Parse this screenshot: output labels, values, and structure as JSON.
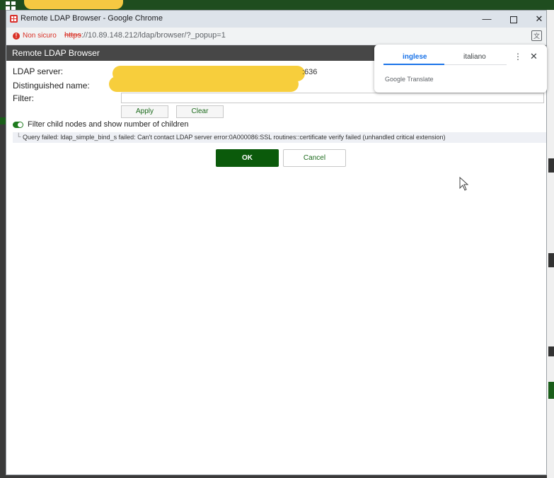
{
  "browser": {
    "window_title": "Remote LDAP Browser - Google Chrome",
    "minimize_glyph": "—",
    "close_glyph": "✕",
    "security_label": "Non sicuro",
    "url_scheme": "https",
    "url_rest": "://10.89.148.212/ldap/browser/?_popup=1"
  },
  "dialog": {
    "title": "Remote LDAP Browser",
    "ldap_server_label": "LDAP server:",
    "ldap_server_port": ":636",
    "dn_label": "Distinguished name:",
    "filter_label": "Filter:",
    "filter_value": "",
    "apply_label": "Apply",
    "clear_label": "Clear",
    "toggle_label": "Filter child nodes and show number of children",
    "toggle_on": true,
    "error_message": "Query failed: ldap_simple_bind_s failed: Can't contact LDAP server error:0A000086:SSL routines::certificate verify failed (unhandled critical extension)",
    "ok_label": "OK",
    "cancel_label": "Cancel"
  },
  "translate_popup": {
    "tab_source": "inglese",
    "tab_target": "italiano",
    "brand": "Google Translate",
    "menu_glyph": "⋮",
    "close_glyph": "✕"
  },
  "colors": {
    "accent_green": "#0b5a0b",
    "error_red": "#d93025",
    "translate_blue": "#1a73e8",
    "redaction_yellow": "#f7ce3c"
  }
}
